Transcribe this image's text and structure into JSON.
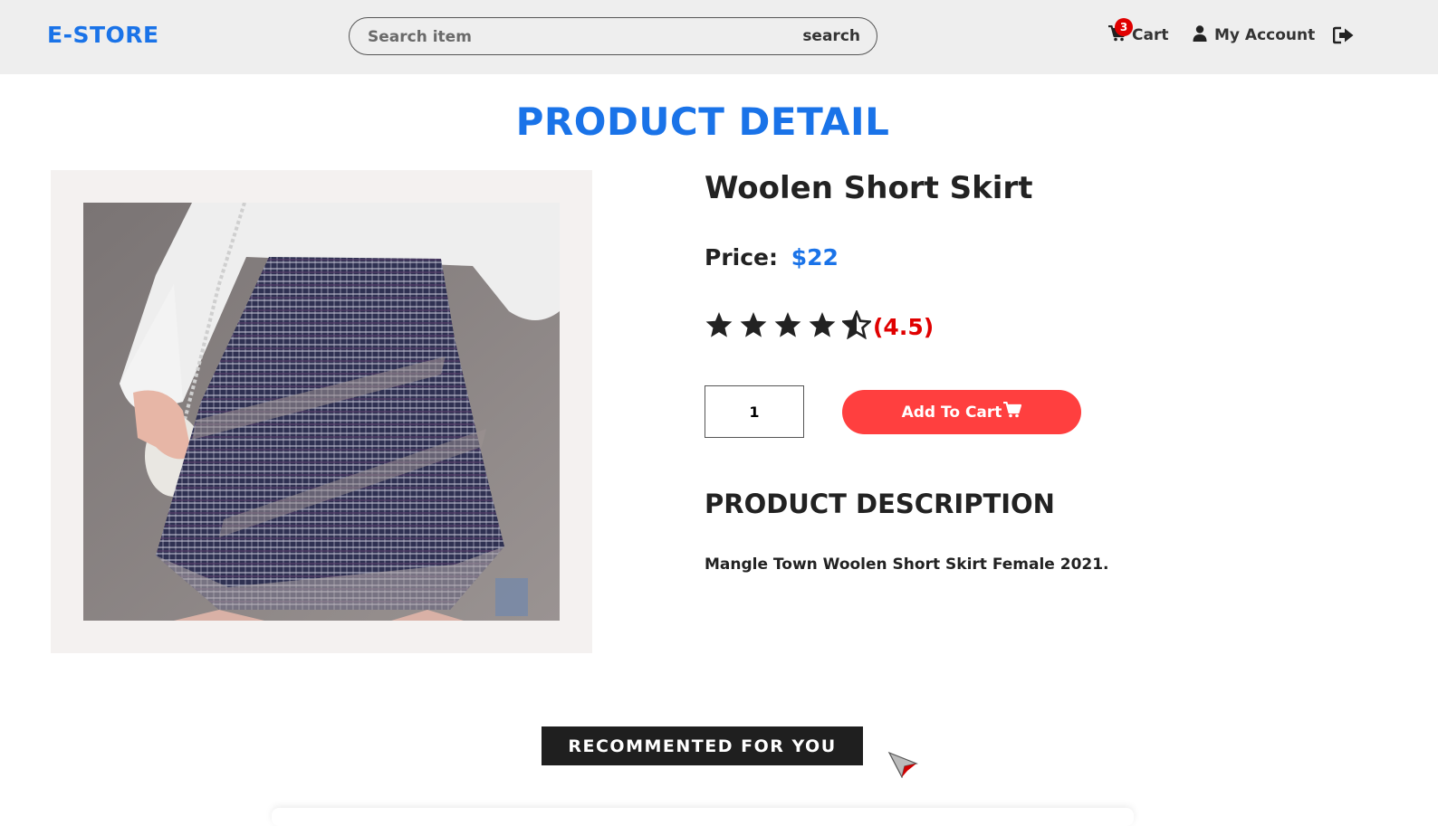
{
  "header": {
    "brand": "E-STORE",
    "search_placeholder": "Search item",
    "search_button": "search",
    "cart_label": "Cart",
    "cart_count": "3",
    "account_label": "My Account",
    "icons": [
      "shopping-cart-icon",
      "user-icon",
      "logout-icon"
    ]
  },
  "page": {
    "title": "PRODUCT DETAIL"
  },
  "product": {
    "name": "Woolen Short Skirt",
    "price_label": "Price:",
    "price_value": "$22",
    "rating": 4.5,
    "rating_text": "(4.5)",
    "quantity": "1",
    "add_to_cart_label": "Add To Cart",
    "description_title": "PRODUCT DESCRIPTION",
    "description": "Mangle Town Woolen Short Skirt Female 2021."
  },
  "recommended": {
    "title": "RECOMMENTED FOR YOU"
  },
  "colors": {
    "accent": "#1a73e8",
    "cta": "#ff3f3f",
    "rating": "#e00000",
    "header_bg": "#eeeeee"
  }
}
